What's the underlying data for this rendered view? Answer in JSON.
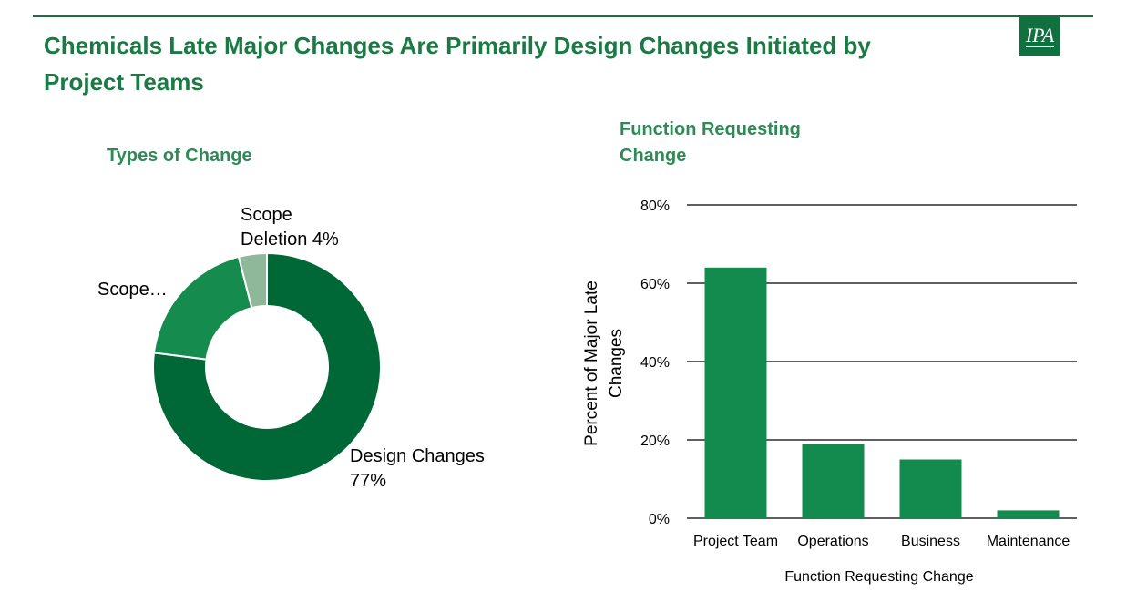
{
  "header": {
    "title": "Chemicals Late Major Changes Are Primarily Design Changes Initiated by Project Teams",
    "logo_text": "IPA"
  },
  "colors": {
    "accent": "#1a7a44",
    "dark_green": "#006837",
    "mid_green": "#158c4d",
    "light_green": "#8fb89a",
    "bar": "#148b4e"
  },
  "chart_data": [
    {
      "type": "pie",
      "donut": true,
      "title": "Types of Change",
      "slices": [
        {
          "label": "Design Changes",
          "value": 77,
          "display": "Design Changes 77%",
          "color": "#006837"
        },
        {
          "label": "Scope…",
          "value": 19,
          "display": "Scope…",
          "color": "#158c4d"
        },
        {
          "label": "Scope Deletion",
          "value": 4,
          "display": "Scope Deletion 4%",
          "color": "#8fb89a"
        }
      ]
    },
    {
      "type": "bar",
      "title": "Function Requesting Change",
      "categories": [
        "Project Team",
        "Operations",
        "Business",
        "Maintenance"
      ],
      "values": [
        64,
        19,
        15,
        2
      ],
      "xlabel": "Function Requesting  Change",
      "ylabel": "Percent of Major Late Changes",
      "ylim": [
        0,
        80
      ],
      "yticks": [
        "0%",
        "20%",
        "40%",
        "60%",
        "80%"
      ],
      "grid": true
    }
  ]
}
